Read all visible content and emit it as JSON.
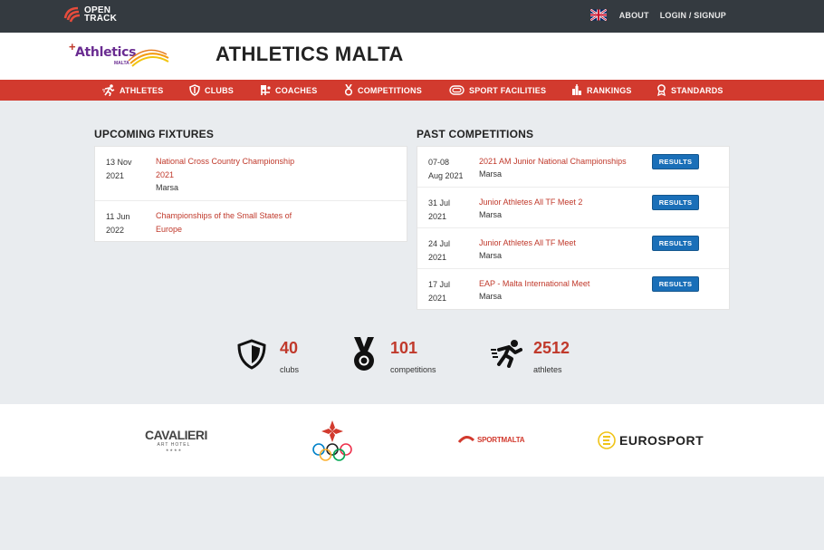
{
  "topbar": {
    "logo_text_1": "OPEN",
    "logo_text_2": "TRACK",
    "about": "ABOUT",
    "login": "LOGIN / SIGNUP"
  },
  "header": {
    "logo_name": "Athletics",
    "logo_sub": "MALTA",
    "title": "ATHLETICS MALTA"
  },
  "nav": [
    {
      "label": "ATHLETES",
      "icon": "runner-icon"
    },
    {
      "label": "CLUBS",
      "icon": "shield-icon"
    },
    {
      "label": "COACHES",
      "icon": "coach-icon"
    },
    {
      "label": "COMPETITIONS",
      "icon": "medal-icon"
    },
    {
      "label": "SPORT FACILITIES",
      "icon": "track-icon"
    },
    {
      "label": "RANKINGS",
      "icon": "rankings-icon"
    },
    {
      "label": "STANDARDS",
      "icon": "standards-icon"
    }
  ],
  "upcoming": {
    "title": "UPCOMING FIXTURES",
    "items": [
      {
        "date_1": "13 Nov",
        "date_2": "2021",
        "name_1": "National Cross Country Championship",
        "name_2": "2021",
        "venue": "Marsa"
      },
      {
        "date_1": "11 Jun",
        "date_2": "2022",
        "name_1": "Championships of the Small States of",
        "name_2": "Europe",
        "venue": ""
      }
    ]
  },
  "past": {
    "title": "PAST COMPETITIONS",
    "button_label": "RESULTS",
    "items": [
      {
        "date_1": "07-08",
        "date_2": "Aug 2021",
        "name": "2021 AM Junior National Championships",
        "venue": "Marsa"
      },
      {
        "date_1": "31 Jul",
        "date_2": "2021",
        "name": "Junior Athletes All TF Meet 2",
        "venue": "Marsa"
      },
      {
        "date_1": "24 Jul",
        "date_2": "2021",
        "name": "Junior Athletes All TF Meet",
        "venue": "Marsa"
      },
      {
        "date_1": "17 Jul",
        "date_2": "2021",
        "name": "EAP - Malta International Meet",
        "venue": "Marsa"
      }
    ]
  },
  "stats": [
    {
      "value": "40",
      "label": "clubs",
      "icon": "shield-icon"
    },
    {
      "value": "101",
      "label": "competitions",
      "icon": "medal-icon"
    },
    {
      "value": "2512",
      "label": "athletes",
      "icon": "runner-icon"
    }
  ],
  "sponsors": {
    "cavalieri_1": "CAVALIERI",
    "cavalieri_2": "ART HOTEL",
    "sportmalta": "SPORTMALTA",
    "eurosport": "EUROSPORT"
  },
  "colors": {
    "topbar": "#343a40",
    "nav": "#d23a2e",
    "accent": "#c0392b",
    "button": "#1a6fb8",
    "logo_purple": "#6a2c91"
  }
}
